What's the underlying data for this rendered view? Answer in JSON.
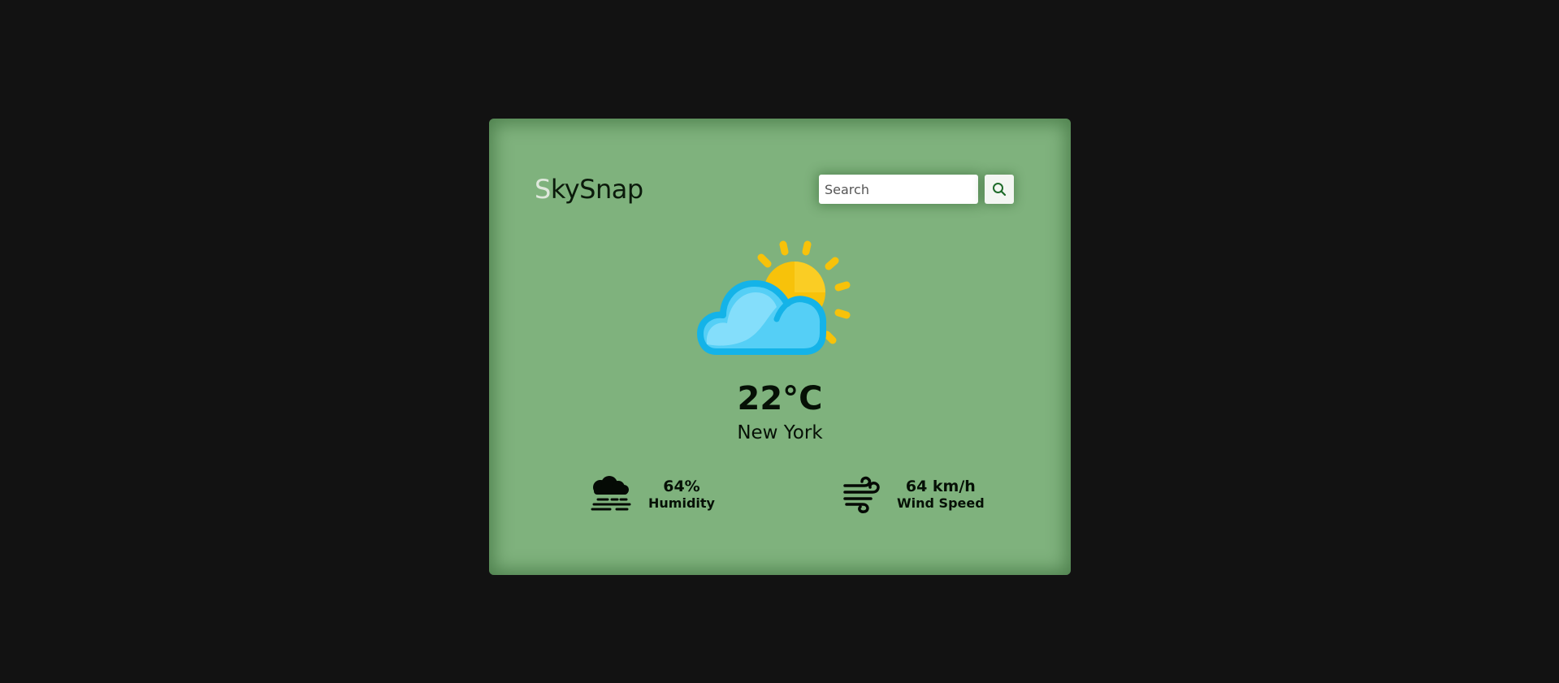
{
  "app": {
    "brand_first_letter": "S",
    "brand_rest": "kySnap"
  },
  "search": {
    "placeholder": "Search",
    "value": "",
    "button_icon": "search-icon"
  },
  "weather": {
    "icon": "partly-cloudy-icon",
    "temperature": "22°C",
    "city": "New York"
  },
  "stats": {
    "humidity": {
      "icon": "humidity-icon",
      "value": "64%",
      "label": "Humidity"
    },
    "wind": {
      "icon": "wind-icon",
      "value": "64 km/h",
      "label": "Wind Speed"
    }
  },
  "colors": {
    "page_background": "#121212",
    "card_background": "#7fb27d",
    "brand_accent": "#dfe8dc",
    "search_icon": "#1f6b2a",
    "sun": "#f7c20a",
    "cloud": "#3ec9f2"
  }
}
